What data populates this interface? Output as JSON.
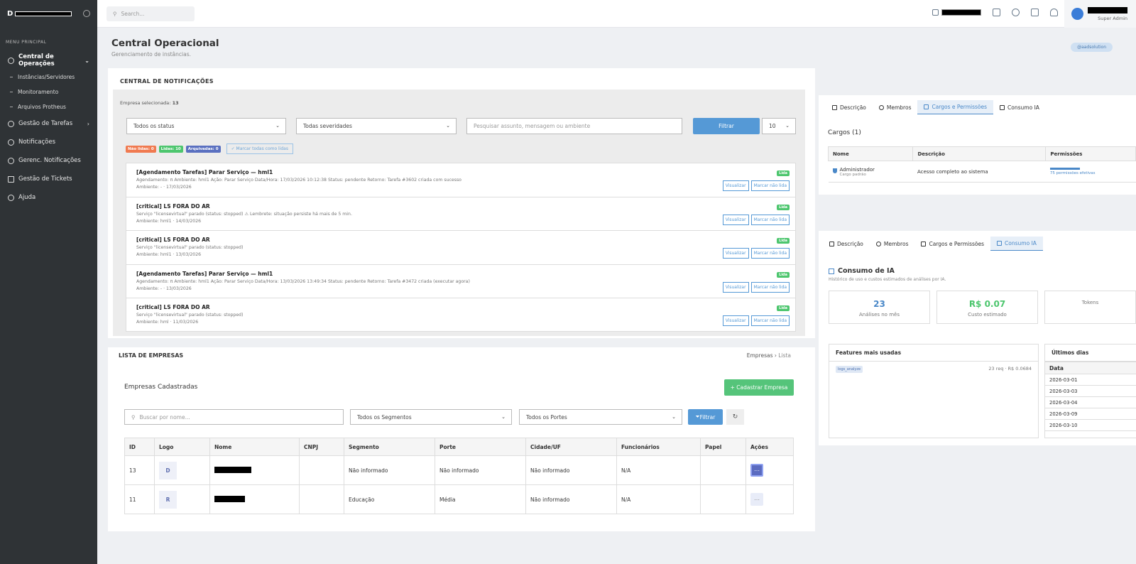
{
  "sidebar": {
    "logo_letter": "D",
    "section": "MENU PRINCIPAL",
    "items": [
      {
        "label": "Central de Operações",
        "icon": "gear-icon"
      },
      {
        "label": "Instâncias/Servidores"
      },
      {
        "label": "Monitoramento"
      },
      {
        "label": "Arquivos Protheus"
      },
      {
        "label": "Gestão de Tarefas",
        "icon": "bell-icon"
      },
      {
        "label": "Notificações",
        "icon": "gear-icon"
      },
      {
        "label": "Gerenc. Notificações",
        "icon": "gear-icon"
      },
      {
        "label": "Gestão de Tickets",
        "icon": "ticket-icon"
      },
      {
        "label": "Ajuda",
        "icon": "help-icon"
      }
    ]
  },
  "topbar": {
    "search_placeholder": "Search...",
    "user_role": "Super Admin"
  },
  "page": {
    "title": "Central Operacional",
    "subtitle": "Gerenciamento de instâncias.",
    "badge": "@aadsolution"
  },
  "notifications": {
    "title": "CENTRAL DE NOTIFICAÇÕES",
    "selected_label": "Empresa selecionada:",
    "selected_value": "13",
    "status_select": "Todos os status",
    "severity_select": "Todas severidades",
    "search_placeholder": "Pesquisar assunto, mensagem ou ambiente",
    "filter_button": "Filtrar",
    "page_size": "10",
    "count_unread": "Não lidas: 0",
    "count_read": "Lidas: 10",
    "count_archived": "Arquivadas: 0",
    "mark_all": "✓ Marcar todas como lidas",
    "items": [
      {
        "title": "[Agendamento Tarefas] Parar Serviço — hml1",
        "message": "Agendamento: π Ambiente: hml1 Ação: Parar Serviço Data/Hora: 17/03/2026 10:12:38 Status: pendente Retorno: Tarefa #3602 criada com sucesso",
        "meta": "Ambiente: - · 17/03/2026",
        "badge": "Lida",
        "view": "Visualizar",
        "unread": "Marcar não lida"
      },
      {
        "title": "[critical] LS FORA DO AR",
        "message": "Serviço \"licensevirtual\" parado (status: stopped) ⚠ Lembrete: situação persiste há mais de 5 min.",
        "meta": "Ambiente: hml1 · 14/03/2026",
        "badge": "Lida",
        "view": "Visualizar",
        "unread": "Marcar não lida"
      },
      {
        "title": "[critical] LS FORA DO AR",
        "message": "Serviço \"licensevirtual\" parado (status: stopped)",
        "meta": "Ambiente: hml1 · 13/03/2026",
        "badge": "Lida",
        "view": "Visualizar",
        "unread": "Marcar não lida"
      },
      {
        "title": "[Agendamento Tarefas] Parar Serviço — hml1",
        "message": "Agendamento: π Ambiente: hml1 Ação: Parar Serviço Data/Hora: 13/03/2026 13:49:34 Status: pendente Retorno: Tarefa #3472 criada (executar agora)",
        "meta": "Ambiente: - · 13/03/2026",
        "badge": "Lida",
        "view": "Visualizar",
        "unread": "Marcar não lida"
      },
      {
        "title": "[critical] LS FORA DO AR",
        "message": "Serviço \"licensevirtual\" parado (status: stopped)",
        "meta": "Ambiente: hml · 11/03/2026",
        "badge": "Lida",
        "view": "Visualizar",
        "unread": "Marcar não lida"
      }
    ]
  },
  "roles_panel": {
    "tabs": [
      "Descrição",
      "Membros",
      "Cargos e Permissões",
      "Consumo IA"
    ],
    "title": "Cargos (1)",
    "headers": [
      "Nome",
      "Descrição",
      "Permissões"
    ],
    "row": {
      "name": "Administrador",
      "sub": "Cargo padrão",
      "desc": "Acesso completo ao sistema",
      "perms": "75 permissões efetivas"
    }
  },
  "ia_panel": {
    "tabs": [
      "Descrição",
      "Membros",
      "Cargos e Permissões",
      "Consumo IA"
    ],
    "title": "Consumo de IA",
    "subtitle": "Histórico de uso e custos estimados de análises por IA.",
    "stat1_value": "23",
    "stat1_label": "Análises no mês",
    "stat2_value": "R$ 0.07",
    "stat2_label": "Custo estimado",
    "stat3_label": "Tokens",
    "features_title": "Features mais usadas",
    "feature_tag": "logs_analyze",
    "feature_value": "23 req · R$ 0.0684",
    "days_title": "Últimos dias",
    "days_header": "Data",
    "days": [
      "2026-03-01",
      "2026-03-03",
      "2026-03-04",
      "2026-03-09",
      "2026-03-10"
    ]
  },
  "companies": {
    "title": "LISTA DE EMPRESAS",
    "crumb1": "Empresas",
    "crumb2": "Lista",
    "card_title": "Empresas Cadastradas",
    "add_button": "+ Cadastrar Empresa",
    "search_placeholder": "Buscar por nome...",
    "segment_select": "Todos os Segmentos",
    "size_select": "Todos os Portes",
    "filter_button": "Filtrar",
    "headers": [
      "ID",
      "Logo",
      "Nome",
      "CNPJ",
      "Segmento",
      "Porte",
      "Cidade/UF",
      "Funcionários",
      "Papel",
      "Ações"
    ],
    "rows": [
      {
        "id": "13",
        "logo": "D",
        "segment": "Não informado",
        "size": "Não informado",
        "city": "Não informado",
        "emp": "N/A"
      },
      {
        "id": "11",
        "logo": "R",
        "segment": "Educação",
        "size": "Média",
        "city": "Não informado",
        "emp": "N/A"
      }
    ]
  }
}
